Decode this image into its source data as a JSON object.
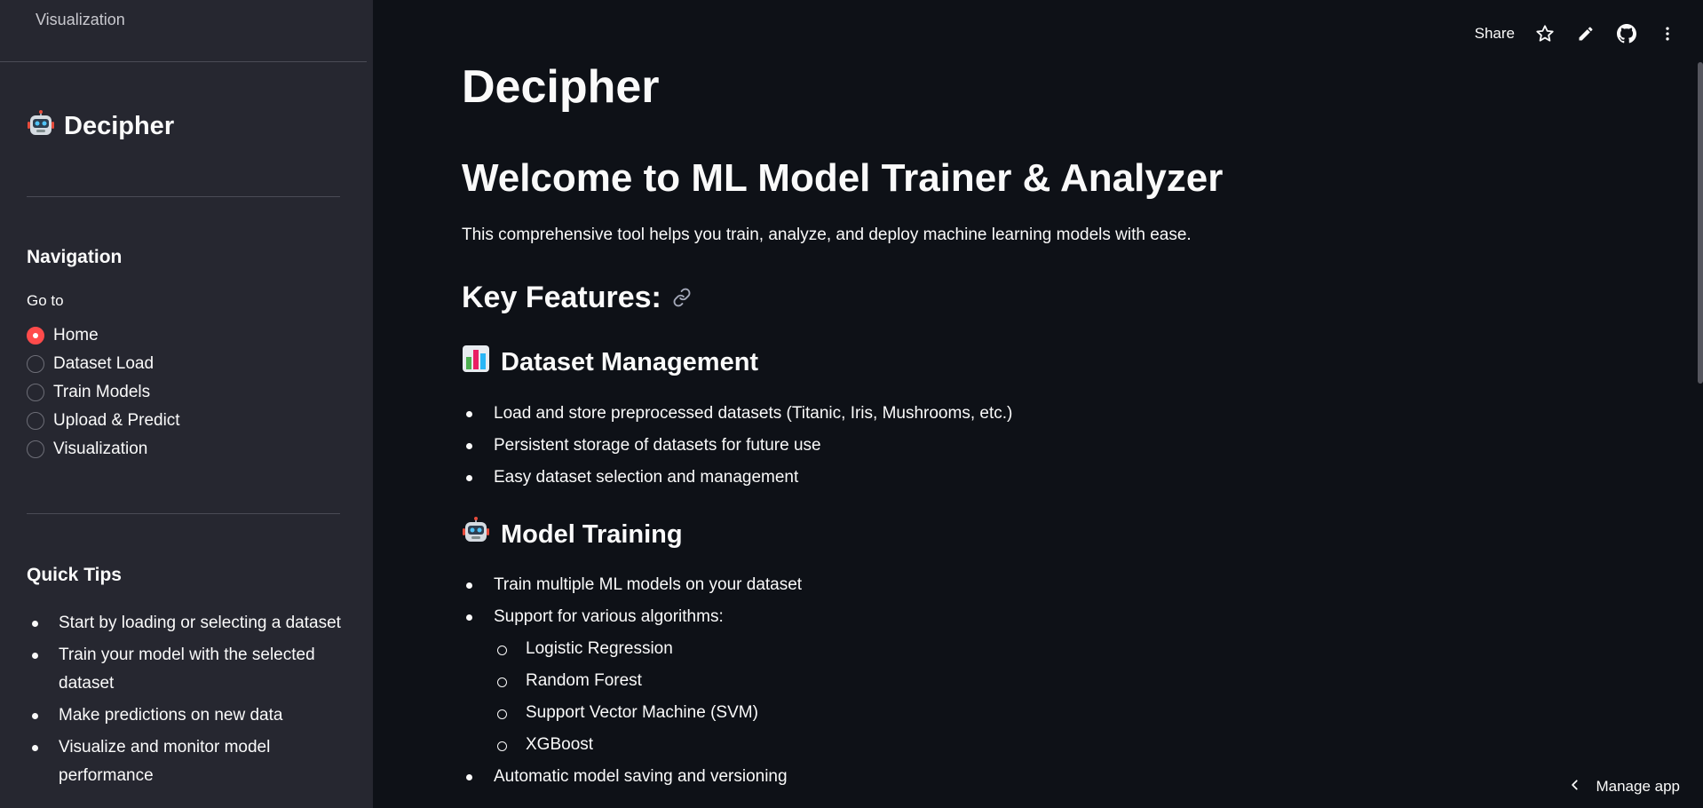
{
  "sidebar": {
    "top_link": "Visualization",
    "brand_title": "Decipher",
    "brand_icon": "robot-icon",
    "nav_heading": "Navigation",
    "goto_label": "Go to",
    "radio_options": [
      {
        "label": "Home",
        "selected": true
      },
      {
        "label": "Dataset Load",
        "selected": false
      },
      {
        "label": "Train Models",
        "selected": false
      },
      {
        "label": "Upload & Predict",
        "selected": false
      },
      {
        "label": "Visualization",
        "selected": false
      }
    ],
    "tips_heading": "Quick Tips",
    "tips": [
      "Start by loading or selecting a dataset",
      "Train your model with the selected dataset",
      "Make predictions on new data",
      "Visualize and monitor model performance"
    ]
  },
  "toolbar": {
    "share_label": "Share",
    "icons": [
      "star-icon",
      "pencil-icon",
      "github-icon",
      "more-vertical-icon"
    ]
  },
  "main": {
    "page_title": "Decipher",
    "welcome": "Welcome to ML Model Trainer & Analyzer",
    "intro": "This comprehensive tool helps you train, analyze, and deploy machine learning models with ease.",
    "key_features": "Key Features:",
    "sections": [
      {
        "icon": "bar-chart-icon",
        "title": "Dataset Management",
        "items": [
          "Load and store preprocessed datasets (Titanic, Iris, Mushrooms, etc.)",
          "Persistent storage of datasets for future use",
          "Easy dataset selection and management"
        ]
      },
      {
        "icon": "robot-icon",
        "title": "Model Training",
        "items": [
          "Train multiple ML models on your dataset",
          "Support for various algorithms:"
        ],
        "sub_items": [
          "Logistic Regression",
          "Random Forest",
          "Support Vector Machine (SVM)",
          "XGBoost"
        ],
        "after_items": [
          "Automatic model saving and versioning"
        ]
      }
    ]
  },
  "footer": {
    "manage_app": "Manage app"
  },
  "colors": {
    "background": "#0e1117",
    "sidebar": "#262730",
    "accent": "#ff4b4b",
    "text": "#fafafa"
  }
}
